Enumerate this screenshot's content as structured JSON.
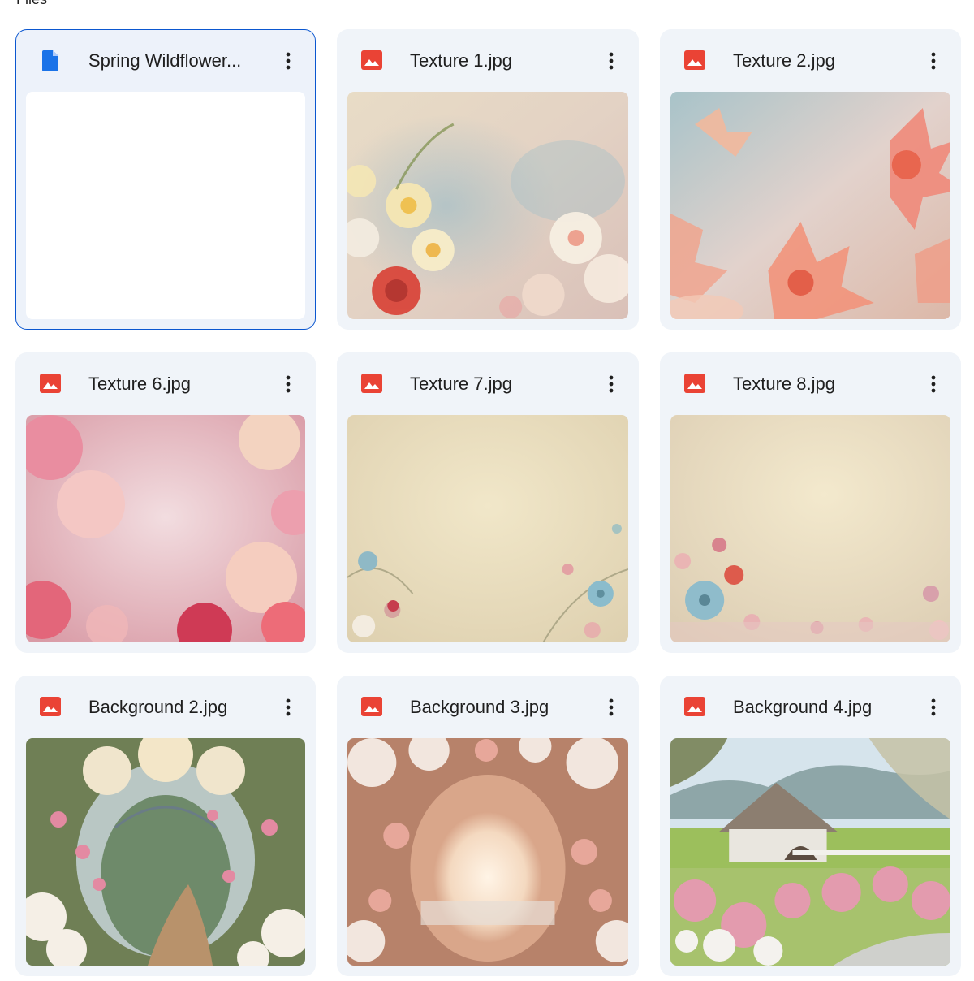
{
  "section": {
    "title": "Files"
  },
  "colors": {
    "selected_border": "#0b57d0",
    "doc_icon": "#1a73e8",
    "image_icon": "#ea4335",
    "card_bg": "#f0f4f9"
  },
  "files": [
    {
      "name": "Spring Wildflower...",
      "type": "doc",
      "icon": "google-docs-icon",
      "selected": true,
      "preview": "blank-document"
    },
    {
      "name": "Texture 1.jpg",
      "type": "image",
      "icon": "image-file-icon",
      "selected": false,
      "preview": "soft-floral-texture"
    },
    {
      "name": "Texture 2.jpg",
      "type": "image",
      "icon": "image-file-icon",
      "selected": false,
      "preview": "coral-lily-texture"
    },
    {
      "name": "Texture 6.jpg",
      "type": "image",
      "icon": "image-file-icon",
      "selected": false,
      "preview": "pink-peony-texture"
    },
    {
      "name": "Texture 7.jpg",
      "type": "image",
      "icon": "image-file-icon",
      "selected": false,
      "preview": "vintage-cream-floral-texture"
    },
    {
      "name": "Texture 8.jpg",
      "type": "image",
      "icon": "image-file-icon",
      "selected": false,
      "preview": "vintage-cream-floral-texture-2"
    },
    {
      "name": "Background 2.jpg",
      "type": "image",
      "icon": "image-file-icon",
      "selected": false,
      "preview": "flower-arch-garden-path"
    },
    {
      "name": "Background 3.jpg",
      "type": "image",
      "icon": "image-file-icon",
      "selected": false,
      "preview": "flower-arch-sunlight"
    },
    {
      "name": "Background 4.jpg",
      "type": "image",
      "icon": "image-file-icon",
      "selected": false,
      "preview": "barn-with-spring-flowers"
    }
  ]
}
